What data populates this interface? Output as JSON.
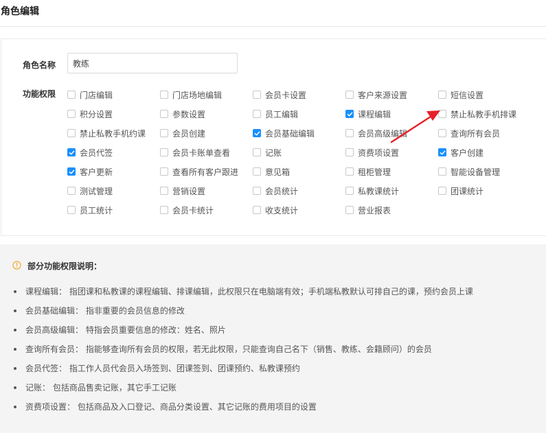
{
  "header": {
    "title": "角色编辑"
  },
  "form": {
    "role_name_label": "角色名称",
    "role_name_value": "教练",
    "permissions_label": "功能权限"
  },
  "permissions": [
    {
      "label": "门店编辑",
      "checked": false
    },
    {
      "label": "门店场地编辑",
      "checked": false
    },
    {
      "label": "会员卡设置",
      "checked": false
    },
    {
      "label": "客户来源设置",
      "checked": false
    },
    {
      "label": "短信设置",
      "checked": false
    },
    {
      "label": "积分设置",
      "checked": false
    },
    {
      "label": "参数设置",
      "checked": false
    },
    {
      "label": "员工编辑",
      "checked": false
    },
    {
      "label": "课程编辑",
      "checked": true
    },
    {
      "label": "禁止私教手机排课",
      "checked": false
    },
    {
      "label": "禁止私教手机约课",
      "checked": false
    },
    {
      "label": "会员创建",
      "checked": false
    },
    {
      "label": "会员基础编辑",
      "checked": true
    },
    {
      "label": "会员高级编辑",
      "checked": false
    },
    {
      "label": "查询所有会员",
      "checked": false
    },
    {
      "label": "会员代签",
      "checked": true
    },
    {
      "label": "会员卡账单查看",
      "checked": false
    },
    {
      "label": "记账",
      "checked": false
    },
    {
      "label": "资费项设置",
      "checked": false
    },
    {
      "label": "客户创建",
      "checked": true
    },
    {
      "label": "客户更新",
      "checked": true
    },
    {
      "label": "查看所有客户跟进",
      "checked": false
    },
    {
      "label": "意见箱",
      "checked": false
    },
    {
      "label": "租柜管理",
      "checked": false
    },
    {
      "label": "智能设备管理",
      "checked": false
    },
    {
      "label": "测试管理",
      "checked": false
    },
    {
      "label": "营销设置",
      "checked": false
    },
    {
      "label": "会员统计",
      "checked": false
    },
    {
      "label": "私教课统计",
      "checked": false
    },
    {
      "label": "团课统计",
      "checked": false
    },
    {
      "label": "员工统计",
      "checked": false
    },
    {
      "label": "会员卡统计",
      "checked": false
    },
    {
      "label": "收支统计",
      "checked": false
    },
    {
      "label": "营业报表",
      "checked": false
    }
  ],
  "notes": {
    "title": "部分功能权限说明：",
    "items": [
      "课程编辑： 指团课和私教课的课程编辑、排课编辑，此权限只在电脑端有效；手机端私教默认可排自己的课，预约会员上课",
      "会员基础编辑： 指非重要的会员信息的修改",
      "会员高级编辑： 特指会员重要信息的修改：姓名、照片",
      "查询所有会员： 指能够查询所有会员的权限，若无此权限，只能查询自己名下（销售、教练、会籍顾问）的会员",
      "会员代签： 指工作人员代会员入场签到、团课签到、团课预约、私教课预约",
      "记账： 包括商品售卖记账，其它手工记账",
      "资费项设置： 包括商品及入口登记、商品分类设置、其它记账的费用项目的设置"
    ]
  },
  "colors": {
    "accent": "#1890ff",
    "annotation_arrow": "#e62129",
    "info_icon": "#f5a623"
  }
}
